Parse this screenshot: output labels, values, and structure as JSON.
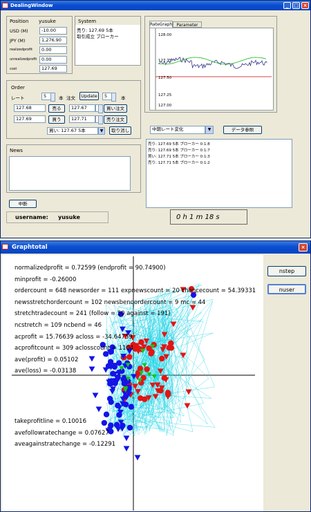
{
  "dealing": {
    "title": "DealingWindow",
    "position": {
      "label": "Position",
      "user": "yusuke",
      "rows": [
        {
          "label": "USD (M)",
          "value": "-10.00"
        },
        {
          "label": "JPY (M)",
          "value": "1,276.90"
        },
        {
          "label": "realizedprofit",
          "value": "0.00"
        },
        {
          "label": "unrealizedprofit",
          "value": "0.00"
        },
        {
          "label": "cost",
          "value": "127.69"
        }
      ]
    },
    "system": {
      "label": "System",
      "line1": "売り: 127.69 5本",
      "line2": "取引成立  ブローカー"
    },
    "graph": {
      "tab1": "RateGraph",
      "tab2": "Parameter Set",
      "ticks": [
        "128.00",
        "127.75",
        "127.50",
        "127.25",
        "127.00"
      ]
    },
    "order": {
      "label": "Order",
      "rate_label": "レート",
      "qty1": "5",
      "unit1": "本",
      "order_label": "注文",
      "update": "Update",
      "qty2": "5",
      "unit2": "本",
      "sell_price": "127.68",
      "sell_btn": "売る",
      "sell_limit": "127.67",
      "buy_limit_btn": "買い注文",
      "buy_price": "127.69",
      "buy_btn": "買う",
      "buy_limit": "127.71",
      "sell_limit_btn": "売り注文",
      "select_value": "買い: 127.67 5本",
      "cancel_btn": "取り消し"
    },
    "news": {
      "label": "News"
    },
    "filter": {
      "value": "中期レート変化",
      "ref_btn": "データ参照"
    },
    "log": [
      "売り:  127.69 5本 ブローカー 0:1:8",
      "売り:  127.69 5本 ブローカー 0:1:7",
      "買い:  127.71 5本 ブローカー 0:1:3",
      "売り:  127.71 5本 ブローカー 0:1:2"
    ],
    "stop_btn": "中断",
    "username_label": "username:",
    "username": "yusuke",
    "timer": "0   h   1   m   18   s"
  },
  "graphtotal": {
    "title": "Graphtotal",
    "nstep": "nstep",
    "nuser": "nuser",
    "stats_top": [
      "normalizedprofit = 0.72599  (endprofit = 90.74900)",
      "minprofit = -0.26000",
      "ordercount = 648 newsorder = 111 expnewscount = 20 chancecount = 54.39331",
      "newsstretchordercount = 102 newsbendordercount = 9 mc = 44",
      "stretchtradecount = 241  (follow = 50 against = 191)",
      "ncstretch = 109 ncbend = 46",
      "acprofit = 15.76639 acloss = -34.64759",
      "acprofitcount = 309 aclosscount = 1104",
      "ave(profit) = 0.05102",
      "ave(loss) = -0.03138"
    ],
    "stats_bottom": [
      "takeprofitline = 0.10016",
      "avefollowratechange = 0.07627",
      "aveagainstratechange = -0.12291"
    ],
    "colors": {
      "trace": "#22d3e6",
      "profit": "#e41414",
      "loss": "#1414e6",
      "neutral": "#19c319"
    }
  }
}
